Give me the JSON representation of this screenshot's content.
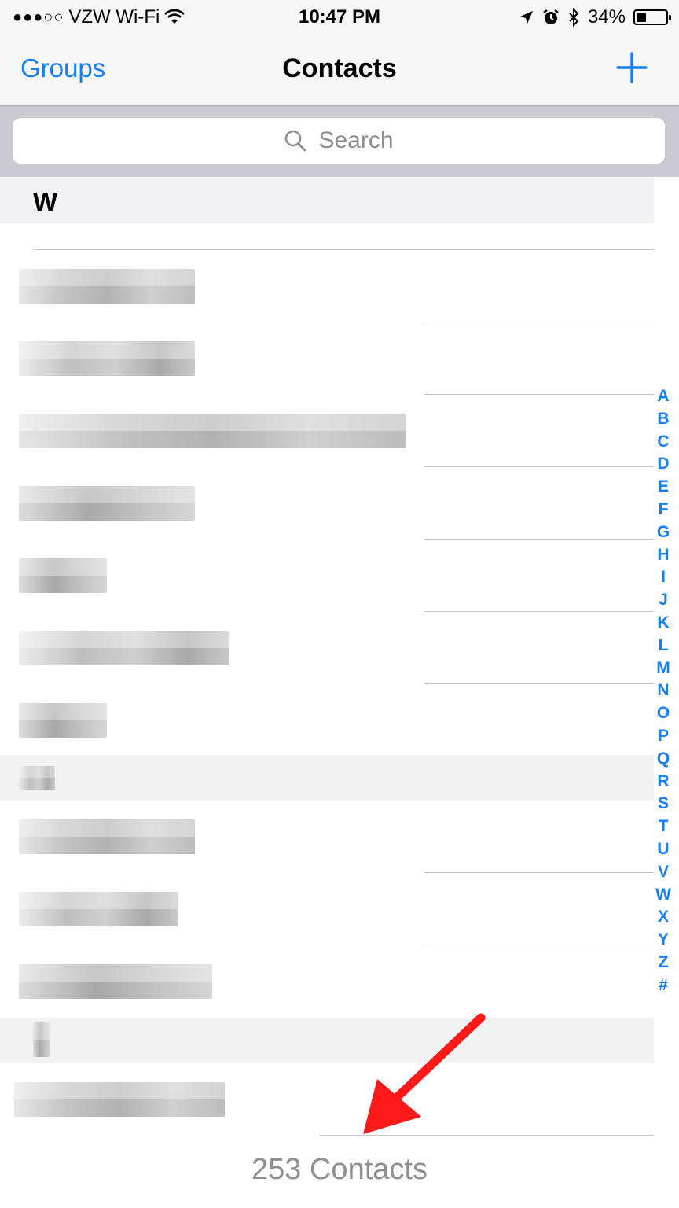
{
  "status_bar": {
    "signal": "●●●○○",
    "carrier": "VZW Wi-Fi",
    "time": "10:47 PM",
    "battery_percent": "34%",
    "icons": [
      "wifi-icon",
      "location-icon",
      "alarm-icon",
      "bluetooth-icon",
      "battery-icon"
    ]
  },
  "nav": {
    "left_label": "Groups",
    "title": "Contacts",
    "add_icon": "plus-icon"
  },
  "search": {
    "placeholder": "Search",
    "icon": "search-icon"
  },
  "section": {
    "letter": "W"
  },
  "index_letters": [
    "A",
    "B",
    "C",
    "D",
    "E",
    "F",
    "G",
    "H",
    "I",
    "J",
    "K",
    "L",
    "M",
    "N",
    "O",
    "P",
    "Q",
    "R",
    "S",
    "T",
    "U",
    "V",
    "W",
    "X",
    "Y",
    "Z",
    "#"
  ],
  "footer": {
    "count_label": "253 Contacts"
  },
  "colors": {
    "accent": "#157efb",
    "annotation_arrow": "#ff1a1a"
  }
}
